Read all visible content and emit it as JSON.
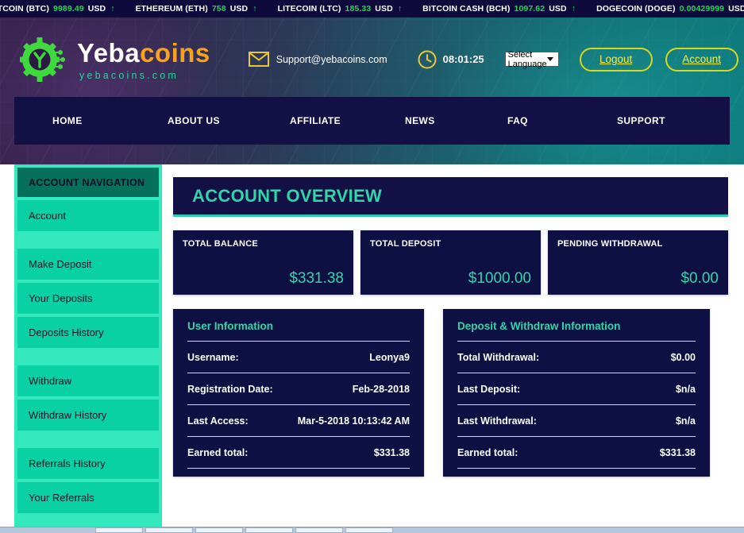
{
  "ticker": [
    {
      "name": "BITCOIN (BTC)",
      "value": "9989.49",
      "currency": "USD",
      "arrow": "↑"
    },
    {
      "name": "ETHEREUM (ETH)",
      "value": "758",
      "currency": "USD",
      "arrow": "↑"
    },
    {
      "name": "LITECOIN (LTC)",
      "value": "185.33",
      "currency": "USD",
      "arrow": "↑"
    },
    {
      "name": "BITCOIN CASH (BCH)",
      "value": "1097.62",
      "currency": "USD",
      "arrow": "↑"
    },
    {
      "name": "DOGECOIN (DOGE)",
      "value": "0.00429999",
      "currency": "USD",
      "arrow": "↑"
    }
  ],
  "header": {
    "logo_word_1": "Yeba",
    "logo_word_2": "coins",
    "logo_subtitle": "yebacoins.com",
    "email": "Support@yebacoins.com",
    "time": "08:01:25",
    "language_selected": "Select Language",
    "logout_label": "Logout",
    "account_label": "Account"
  },
  "nav": [
    {
      "label": "HOME"
    },
    {
      "label": "ABOUT US"
    },
    {
      "label": "AFFILIATE"
    },
    {
      "label": "NEWS"
    },
    {
      "label": "FAQ"
    },
    {
      "label": "SUPPORT"
    }
  ],
  "sidebar": {
    "heading": "ACCOUNT NAVIGATION",
    "groups": [
      {
        "items": [
          {
            "label": "Account"
          }
        ]
      },
      {
        "items": [
          {
            "label": "Make Deposit"
          },
          {
            "label": "Your Deposits"
          },
          {
            "label": "Deposits History"
          }
        ]
      },
      {
        "items": [
          {
            "label": "Withdraw"
          },
          {
            "label": "Withdraw History"
          }
        ]
      },
      {
        "items": [
          {
            "label": "Referrals History"
          },
          {
            "label": "Your Referrals"
          }
        ]
      }
    ]
  },
  "main": {
    "page_title": "ACCOUNT OVERVIEW",
    "stats": [
      {
        "label": "TOTAL BALANCE",
        "value": "$331.38"
      },
      {
        "label": "TOTAL DEPOSIT",
        "value": "$1000.00"
      },
      {
        "label": "PENDING WITHDRAWAL",
        "value": "$0.00"
      }
    ],
    "user_panel": {
      "heading": "User Information",
      "rows": [
        {
          "key": "Username:",
          "value": "Leonya9"
        },
        {
          "key": "Registration Date:",
          "value": "Feb-28-2018"
        },
        {
          "key": "Last Access:",
          "value": "Mar-5-2018 10:13:42 AM"
        },
        {
          "key": "Earned total:",
          "value": "$331.38"
        }
      ]
    },
    "deposit_panel": {
      "heading": "Deposit & Withdraw Information",
      "rows": [
        {
          "key": "Total Withdrawal:",
          "value": "$0.00"
        },
        {
          "key": "Last Deposit:",
          "value": "$n/a"
        },
        {
          "key": "Last Withdrawal:",
          "value": "$n/a"
        },
        {
          "key": "Earned total:",
          "value": "$331.38"
        }
      ]
    }
  },
  "colors": {
    "ticker_bg": "#0e0a3c",
    "ticker_value": "#1fd655",
    "panel_bg": "#0e1043",
    "accent_teal": "#2fd6a8",
    "sidebar_bg": "#34e8bd",
    "sidebar_item": "#0ad1a5",
    "sidebar_head": "#06705a",
    "logo_orange": "#f6a21d",
    "button_yellow": "#d8d81f"
  }
}
